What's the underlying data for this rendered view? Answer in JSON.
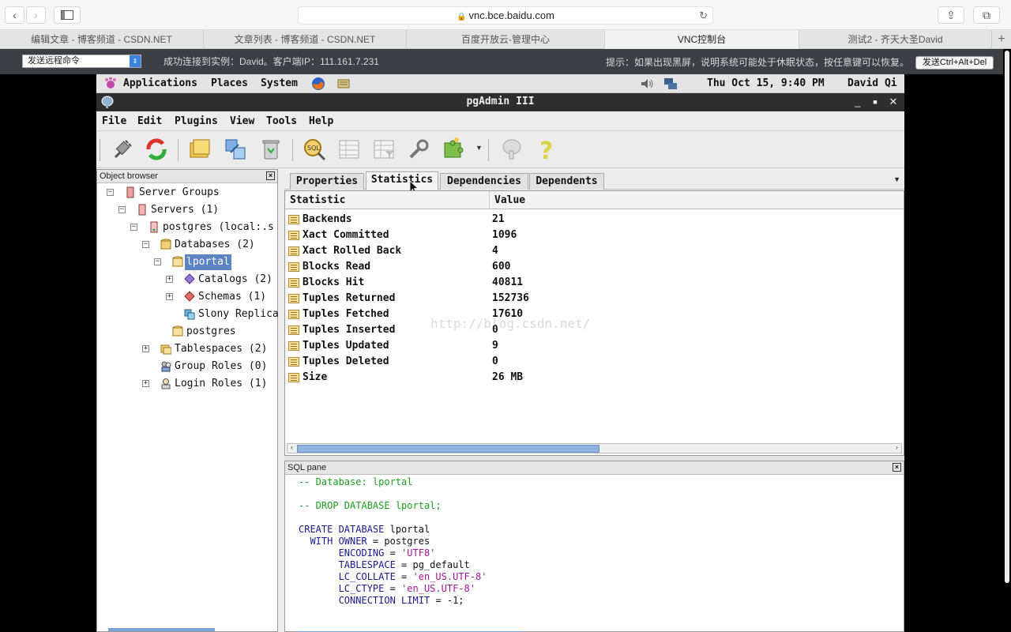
{
  "browser": {
    "url": "vnc.bce.baidu.com",
    "tabs": [
      {
        "label": "编辑文章 - 博客频道 - CSDN.NET",
        "active": false
      },
      {
        "label": "文章列表 - 博客频道 - CSDN.NET",
        "active": false
      },
      {
        "label": "百度开放云-管理中心",
        "active": false
      },
      {
        "label": "VNC控制台",
        "active": true
      },
      {
        "label": "测试2 - 齐天大圣David",
        "active": false
      }
    ]
  },
  "vnc": {
    "command_select": "发送远程命令",
    "status": "成功连接到实例：David。客户端IP：111.161.7.231",
    "hint": "提示：如果出现黑屏，说明系统可能处于休眠状态，按任意键可以恢复。",
    "cad_button": "发送Ctrl+Alt+Del"
  },
  "gnome": {
    "applications": "Applications",
    "places": "Places",
    "system": "System",
    "clock": "Thu Oct 15,  9:40 PM",
    "user": "David Qi"
  },
  "window": {
    "title": "pgAdmin III",
    "menu": [
      "File",
      "Edit",
      "Plugins",
      "View",
      "Tools",
      "Help"
    ]
  },
  "object_browser": {
    "title": "Object browser",
    "nodes": {
      "server_groups": "Server Groups",
      "servers": "Servers (1)",
      "postgres_server": "postgres (local:.s",
      "databases": "Databases (2)",
      "lportal": "lportal",
      "catalogs": "Catalogs (2)",
      "schemas": "Schemas (1)",
      "slony": "Slony Replica",
      "postgres_db": "postgres",
      "tablespaces": "Tablespaces (2)",
      "group_roles": "Group Roles (0)",
      "login_roles": "Login Roles (1)"
    }
  },
  "properties": {
    "tabs": [
      "Properties",
      "Statistics",
      "Dependencies",
      "Dependents"
    ],
    "active_tab": "Statistics",
    "columns": {
      "statistic": "Statistic",
      "value": "Value"
    },
    "rows": [
      {
        "name": "Backends",
        "value": "21"
      },
      {
        "name": "Xact Committed",
        "value": "1096"
      },
      {
        "name": "Xact Rolled Back",
        "value": "4"
      },
      {
        "name": "Blocks Read",
        "value": "600"
      },
      {
        "name": "Blocks Hit",
        "value": "40811"
      },
      {
        "name": "Tuples Returned",
        "value": "152736"
      },
      {
        "name": "Tuples Fetched",
        "value": "17610"
      },
      {
        "name": "Tuples Inserted",
        "value": "0"
      },
      {
        "name": "Tuples Updated",
        "value": "9"
      },
      {
        "name": "Tuples Deleted",
        "value": "0"
      },
      {
        "name": "Size",
        "value": "26 MB"
      }
    ],
    "watermark": "http://blog.csdn.net/"
  },
  "sql_pane": {
    "title": "SQL pane",
    "l1": "-- Database: lportal",
    "l2": "-- DROP DATABASE lportal;",
    "l3a": "CREATE DATABASE",
    "l3b": " lportal",
    "l4a": "  WITH OWNER",
    "l4b": " = postgres",
    "l5a": "       ENCODING",
    "l5b": " = ",
    "l5c": "'UTF8'",
    "l6a": "       TABLESPACE",
    "l6b": " = pg_default",
    "l7a": "       LC_COLLATE",
    "l7b": " = ",
    "l7c": "'en_US.UTF-8'",
    "l8a": "       LC_CTYPE",
    "l8b": " = ",
    "l8c": "'en_US.UTF-8'",
    "l9a": "       CONNECTION LIMIT",
    "l9b": " = -1;"
  }
}
